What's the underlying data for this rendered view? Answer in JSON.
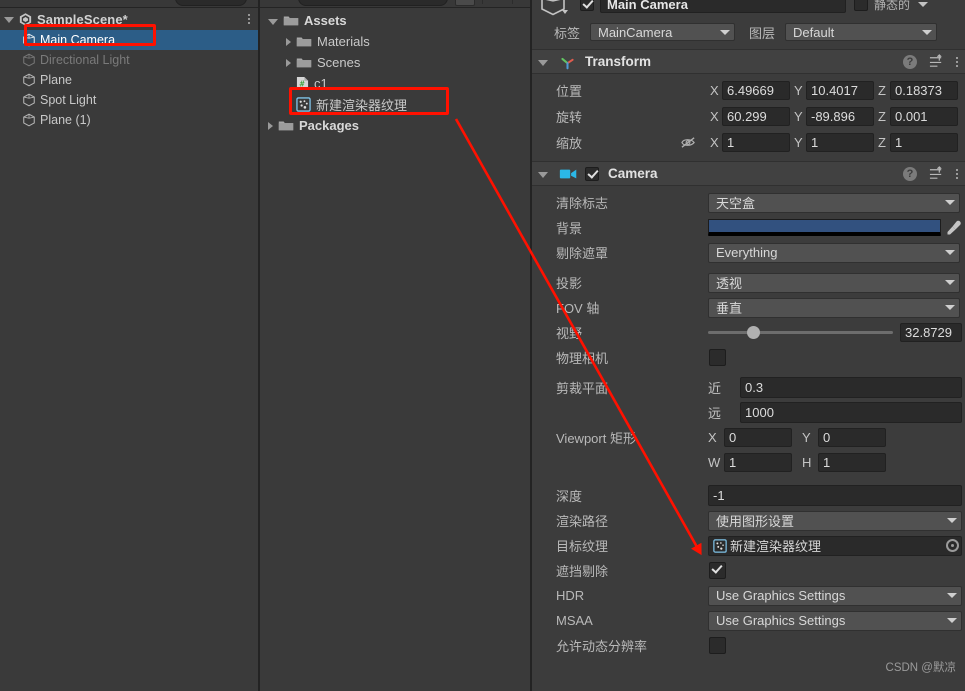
{
  "hierarchy": {
    "scene_title": "SampleScene*",
    "items": [
      {
        "label": "Main Camera",
        "selected": true,
        "dim": false
      },
      {
        "label": "Directional Light",
        "selected": false,
        "dim": true
      },
      {
        "label": "Plane",
        "selected": false,
        "dim": false
      },
      {
        "label": "Spot Light",
        "selected": false,
        "dim": false
      },
      {
        "label": "Plane (1)",
        "selected": false,
        "dim": false
      }
    ]
  },
  "project": {
    "items": [
      {
        "label": "Assets",
        "indent": 0,
        "arrow": "open",
        "icon": "folder",
        "bold": true
      },
      {
        "label": "Materials",
        "indent": 1,
        "arrow": "closed",
        "icon": "folder",
        "bold": false
      },
      {
        "label": "Scenes",
        "indent": 1,
        "arrow": "closed",
        "icon": "folder",
        "bold": false
      },
      {
        "label": "c1",
        "indent": 2,
        "arrow": "none",
        "icon": "script",
        "bold": false
      },
      {
        "label": "新建渲染器纹理",
        "indent": 2,
        "arrow": "none",
        "icon": "rendertexture",
        "bold": false
      },
      {
        "label": "Packages",
        "indent": 0,
        "arrow": "closed",
        "icon": "folder",
        "bold": true
      }
    ]
  },
  "inspector": {
    "gameobject": {
      "name": "Main Camera",
      "enabled": true,
      "static_label": "静态的",
      "static_checked": false,
      "tag_label": "标签",
      "tag_value": "MainCamera",
      "layer_label": "图层",
      "layer_value": "Default"
    },
    "transform": {
      "title": "Transform",
      "rows": [
        {
          "label": "位置",
          "x": "6.49669",
          "y": "10.4017",
          "z": "0.18373"
        },
        {
          "label": "旋转",
          "x": "60.299",
          "y": "-89.896",
          "z": "0.001"
        },
        {
          "label": "缩放",
          "x": "1",
          "y": "1",
          "z": "1"
        }
      ],
      "axis_x": "X",
      "axis_y": "Y",
      "axis_z": "Z"
    },
    "camera": {
      "title": "Camera",
      "enabled": true,
      "clear_flags_label": "清除标志",
      "clear_flags_value": "天空盒",
      "background_label": "背景",
      "background_color": "#32517f",
      "culling_mask_label": "剔除遮罩",
      "culling_mask_value": "Everything",
      "projection_label": "投影",
      "projection_value": "透视",
      "fov_axis_label": "FOV 轴",
      "fov_axis_value": "垂直",
      "field_of_view_label": "视野",
      "field_of_view_value": "32.8729",
      "field_of_view_slider_pct": 21,
      "physical_camera_label": "物理相机",
      "physical_camera_checked": false,
      "clipping_planes_label": "剪裁平面",
      "near_label": "近",
      "near_value": "0.3",
      "far_label": "远",
      "far_value": "1000",
      "viewport_rect_label": "Viewport 矩形",
      "viewport_x_label": "X",
      "viewport_x": "0",
      "viewport_y_label": "Y",
      "viewport_y": "0",
      "viewport_w_label": "W",
      "viewport_w": "1",
      "viewport_h_label": "H",
      "viewport_h": "1",
      "depth_label": "深度",
      "depth_value": "-1",
      "rendering_path_label": "渲染路径",
      "rendering_path_value": "使用图形设置",
      "target_texture_label": "目标纹理",
      "target_texture_value": "新建渲染器纹理",
      "occlusion_culling_label": "遮挡剔除",
      "occlusion_culling_checked": true,
      "hdr_label": "HDR",
      "hdr_value": "Use Graphics Settings",
      "msaa_label": "MSAA",
      "msaa_value": "Use Graphics Settings",
      "dynamic_resolution_label": "允许动态分辨率",
      "dynamic_resolution_checked": false
    }
  },
  "annotations": {
    "accent_color": "#ff1100",
    "watermark": "CSDN @默凉"
  }
}
